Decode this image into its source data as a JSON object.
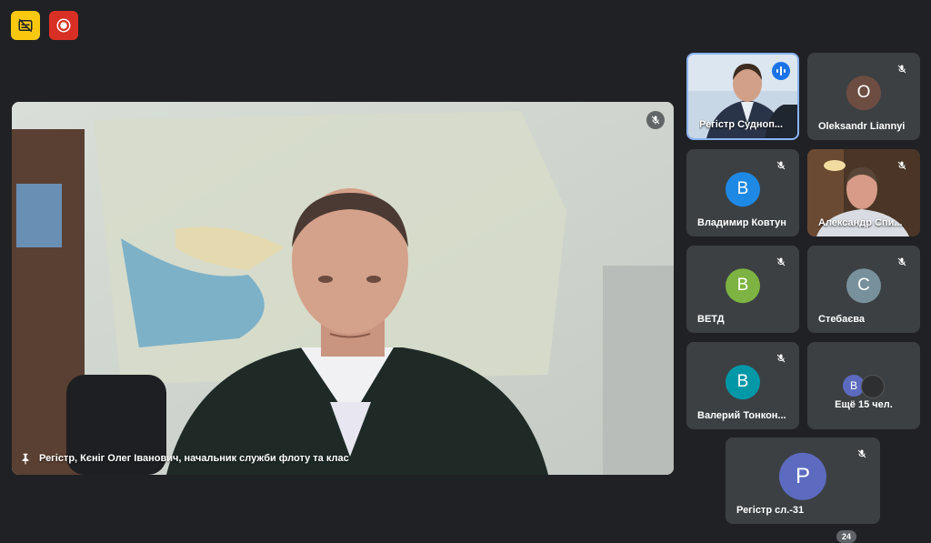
{
  "toolbar": {
    "captions_icon": "captions-off-icon",
    "record_icon": "record-icon",
    "captions_color": "#f9c80e",
    "record_color": "#d93025"
  },
  "main": {
    "caption": "Регістр, Кєніг Олег Іванович, начальник служби флоту та клас",
    "pin_icon": "pin-icon",
    "mic_icon": "mic-off-icon"
  },
  "participants": [
    {
      "name": "Регістр Судноп...",
      "type": "video",
      "speaking": true
    },
    {
      "name": "Oleksandr Liannyi",
      "initial": "O",
      "color": "#6d4c41"
    },
    {
      "name": "Владимир Ковтун",
      "initial": "В",
      "color": "#1e88e5"
    },
    {
      "name": "Александр Спи...",
      "type": "video"
    },
    {
      "name": "ВЕТД",
      "initial": "В",
      "color": "#7cb342"
    },
    {
      "name": "Стебаєва",
      "initial": "С",
      "color": "#78909c"
    },
    {
      "name": "Валерий Тонкон...",
      "initial": "В",
      "color": "#0097a7"
    },
    {
      "name": "Регістр сл.-31",
      "initial": "Р",
      "color": "#5c6bc0"
    }
  ],
  "more": {
    "label": "Ещё 15 чел.",
    "avatar_initial": "В",
    "avatar_color": "#5c6bc0"
  },
  "badge": "24"
}
